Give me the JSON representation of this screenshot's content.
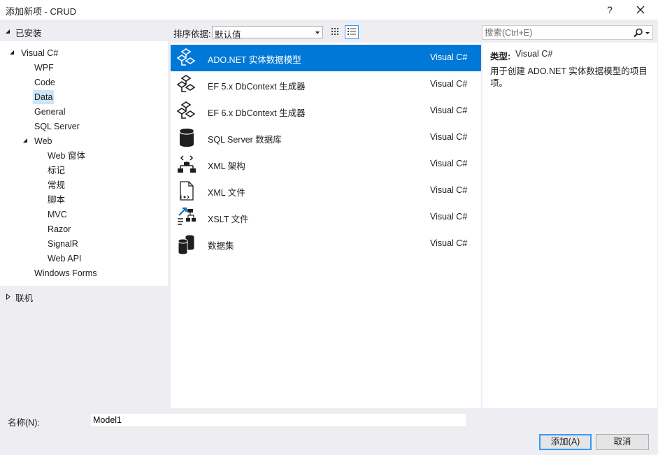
{
  "window": {
    "title": "添加新项 - CRUD",
    "help_label": "?",
    "close_icon": "close-icon"
  },
  "sidebar": {
    "installed_label": "已安装",
    "tree": [
      {
        "label": "Visual C#",
        "expanded": true
      },
      {
        "label": "WPF"
      },
      {
        "label": "Code"
      },
      {
        "label": "Data",
        "selected": true
      },
      {
        "label": "General"
      },
      {
        "label": "SQL Server"
      },
      {
        "label": "Web",
        "expanded": true
      },
      {
        "label": "Web 窗体"
      },
      {
        "label": "标记"
      },
      {
        "label": "常规"
      },
      {
        "label": "脚本"
      },
      {
        "label": "MVC"
      },
      {
        "label": "Razor"
      },
      {
        "label": "SignalR"
      },
      {
        "label": "Web API"
      },
      {
        "label": "Windows Forms"
      }
    ],
    "online_label": "联机"
  },
  "toolbar": {
    "sort_label": "排序依据:",
    "sort_value": "默认值",
    "grid_view_icon": "grid-view-icon",
    "list_view_icon": "list-view-icon"
  },
  "search": {
    "placeholder": "搜索(Ctrl+E)",
    "icon": "search-icon"
  },
  "templates": [
    {
      "name": "ADO.NET 实体数据模型",
      "lang": "Visual C#",
      "icon": "entity-model-icon",
      "selected": true
    },
    {
      "name": "EF 5.x DbContext 生成器",
      "lang": "Visual C#",
      "icon": "entity-model-icon"
    },
    {
      "name": "EF 6.x DbContext 生成器",
      "lang": "Visual C#",
      "icon": "entity-model-icon"
    },
    {
      "name": "SQL Server 数据库",
      "lang": "Visual C#",
      "icon": "database-icon"
    },
    {
      "name": "XML 架构",
      "lang": "Visual C#",
      "icon": "xml-schema-icon"
    },
    {
      "name": "XML 文件",
      "lang": "Visual C#",
      "icon": "xml-file-icon"
    },
    {
      "name": "XSLT 文件",
      "lang": "Visual C#",
      "icon": "xslt-file-icon"
    },
    {
      "name": "数据集",
      "lang": "Visual C#",
      "icon": "dataset-icon"
    }
  ],
  "detail": {
    "type_label": "类型:",
    "type_value": "Visual C#",
    "description": "用于创建 ADO.NET 实体数据模型的项目项。"
  },
  "footer": {
    "name_label": "名称(N):",
    "name_value": "Model1",
    "add_label": "添加(A)",
    "cancel_label": "取消"
  },
  "colors": {
    "accent": "#0078d7",
    "selection_light": "#cce4f7",
    "background": "#eeeef2"
  }
}
